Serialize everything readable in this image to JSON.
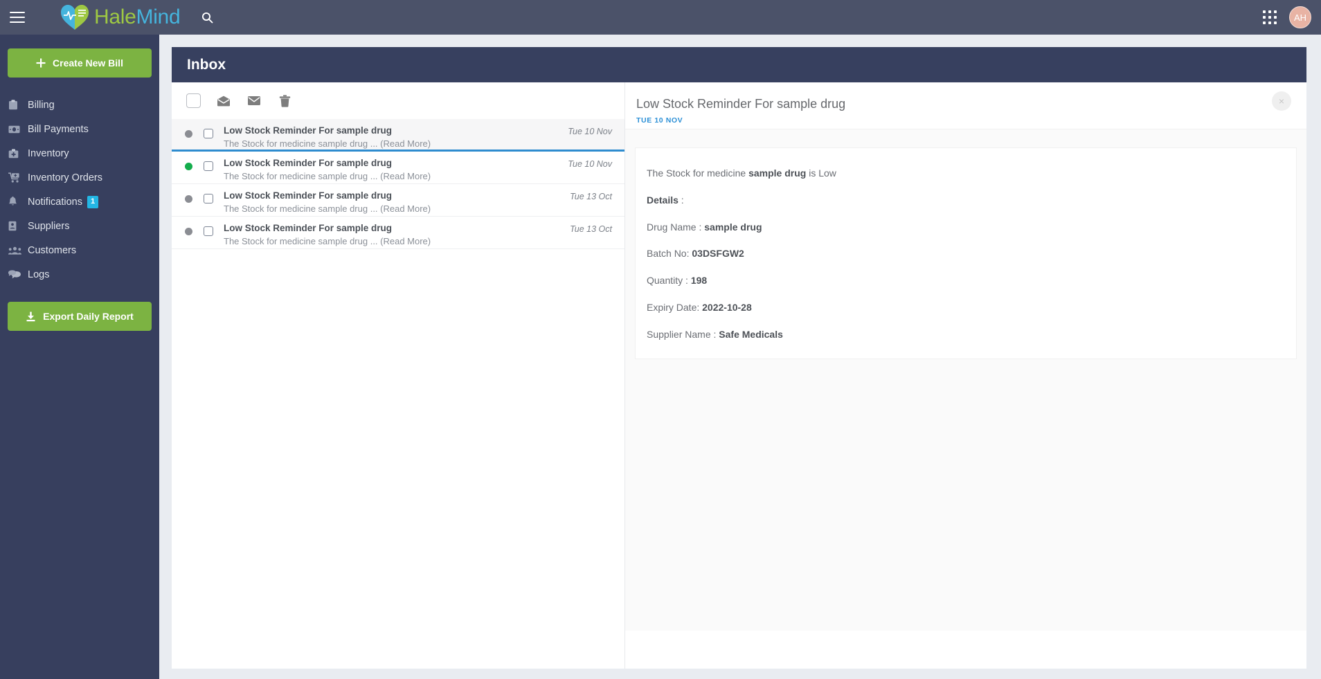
{
  "app": {
    "brand_hale": "Hale",
    "brand_mind": "Mind",
    "hamburger_label": "menu-toggle",
    "search_icon": "search-icon",
    "apps_icon": "apps-grid-icon",
    "avatar_initials": "AH"
  },
  "sidebar": {
    "create_bill_label": "Create New Bill",
    "export_label": "Export Daily Report",
    "items": [
      {
        "label": "Billing",
        "icon": "clipboard-icon"
      },
      {
        "label": "Bill Payments",
        "icon": "money-bill-icon"
      },
      {
        "label": "Inventory",
        "icon": "medical-kit-icon"
      },
      {
        "label": "Inventory Orders",
        "icon": "cart-plus-icon"
      },
      {
        "label": "Notifications",
        "icon": "bell-icon",
        "badge": "1"
      },
      {
        "label": "Suppliers",
        "icon": "id-card-icon"
      },
      {
        "label": "Customers",
        "icon": "users-icon"
      },
      {
        "label": "Logs",
        "icon": "comments-icon"
      }
    ]
  },
  "inbox": {
    "title": "Inbox",
    "toolbar": {
      "select_all": "select-all-checkbox",
      "mark_read_icon": "envelope-open-icon",
      "mark_unread_icon": "envelope-closed-icon",
      "delete_icon": "trash-icon"
    },
    "messages": [
      {
        "subject": "Low Stock Reminder For sample drug",
        "preview": "The Stock for medicine sample drug ... (Read More)",
        "date": "Tue 10 Nov",
        "unread": false,
        "active": true
      },
      {
        "subject": "Low Stock Reminder For sample drug",
        "preview": "The Stock for medicine sample drug ... (Read More)",
        "date": "Tue 10 Nov",
        "unread": true,
        "active": false
      },
      {
        "subject": "Low Stock Reminder For sample drug",
        "preview": "The Stock for medicine sample drug ... (Read More)",
        "date": "Tue 13 Oct",
        "unread": false,
        "active": false
      },
      {
        "subject": "Low Stock Reminder For sample drug",
        "preview": "The Stock for medicine sample drug ... (Read More)",
        "date": "Tue 13 Oct",
        "unread": false,
        "active": false
      }
    ]
  },
  "detail": {
    "title": "Low Stock Reminder For sample drug",
    "date": "TUE 10 NOV",
    "close_label": "×",
    "body": {
      "intro_pre": "The Stock for medicine ",
      "intro_strong": "sample drug",
      "intro_post": " is Low",
      "details_label": "Details",
      "details_colon": " :",
      "drug_name_label": "Drug Name : ",
      "drug_name_value": "sample drug",
      "batch_label": "Batch No: ",
      "batch_value": "03DSFGW2",
      "quantity_label": "Quantity : ",
      "quantity_value": "198",
      "expiry_label": "Expiry Date: ",
      "expiry_value": "2022-10-28",
      "supplier_label": "Supplier Name : ",
      "supplier_value": "Safe Medicals"
    }
  },
  "colors": {
    "topbar": "#4b5269",
    "sidebar": "#373f5e",
    "inbox_header": "#37405f",
    "green_button": "#7cb342",
    "badge_blue": "#23b7e5",
    "active_border": "#2e8ccf",
    "unread_dot": "#14ad4c",
    "read_dot": "#8b8d93",
    "detail_date": "#2b8fd6",
    "avatar": "#e8b3a4",
    "brand_green": "#9ec843",
    "brand_blue": "#45b4dd",
    "page_bg": "#e9ecf1"
  }
}
